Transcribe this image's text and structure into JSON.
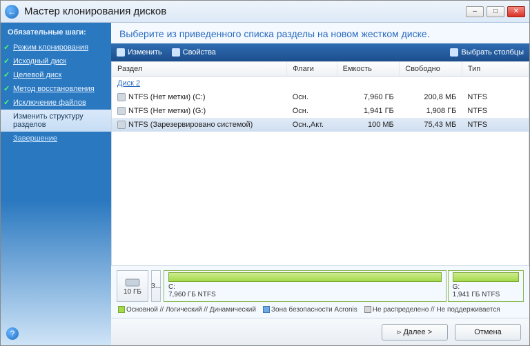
{
  "window": {
    "title": "Мастер клонирования дисков"
  },
  "sidebar": {
    "heading": "Обязательные шаги:",
    "items": [
      {
        "label": "Режим клонирования",
        "state": "done"
      },
      {
        "label": "Исходный диск",
        "state": "done"
      },
      {
        "label": "Целевой диск",
        "state": "done"
      },
      {
        "label": "Метод восстановления",
        "state": "done"
      },
      {
        "label": "Исключение файлов",
        "state": "done"
      },
      {
        "label": "Изменить структуру разделов",
        "state": "active"
      },
      {
        "label": "Завершение",
        "state": "pending"
      }
    ]
  },
  "main": {
    "instruction": "Выберите из приведенного списка разделы на новом жестком диске.",
    "toolbar": {
      "edit": "Изменить",
      "properties": "Свойства",
      "columns": "Выбрать столбцы"
    },
    "columns": {
      "partition": "Раздел",
      "flags": "Флаги",
      "capacity": "Емкость",
      "free": "Свободно",
      "type": "Тип"
    },
    "group": "Диск 2",
    "rows": [
      {
        "partition": "NTFS (Нет метки) (C:)",
        "flags": "Осн.",
        "capacity": "7,960 ГБ",
        "free": "200,8 МБ",
        "type": "NTFS",
        "selected": false
      },
      {
        "partition": "NTFS (Нет метки) (G:)",
        "flags": "Осн.",
        "capacity": "1,941 ГБ",
        "free": "1,908 ГБ",
        "type": "NTFS",
        "selected": false
      },
      {
        "partition": "NTFS (Зарезервировано системой)",
        "flags": "Осн.,Акт.",
        "capacity": "100 МБ",
        "free": "75,43 МБ",
        "type": "NTFS",
        "selected": true
      }
    ],
    "disk_layout": {
      "total_label": "10 ГБ",
      "small_label": "З...",
      "partitions": [
        {
          "title": "C:",
          "sub": "7,960 ГБ  NTFS",
          "flex": 7.96
        },
        {
          "title": "G:",
          "sub": "1,941 ГБ  NTFS",
          "flex": 1.94
        }
      ]
    },
    "legend": {
      "primary": "Основной // Логический // Динамический",
      "acronis_zone": "Зона безопасности Acronis",
      "unallocated": "Не распределено // Не поддерживается"
    }
  },
  "footer": {
    "next": "Далее >",
    "cancel": "Отмена"
  }
}
